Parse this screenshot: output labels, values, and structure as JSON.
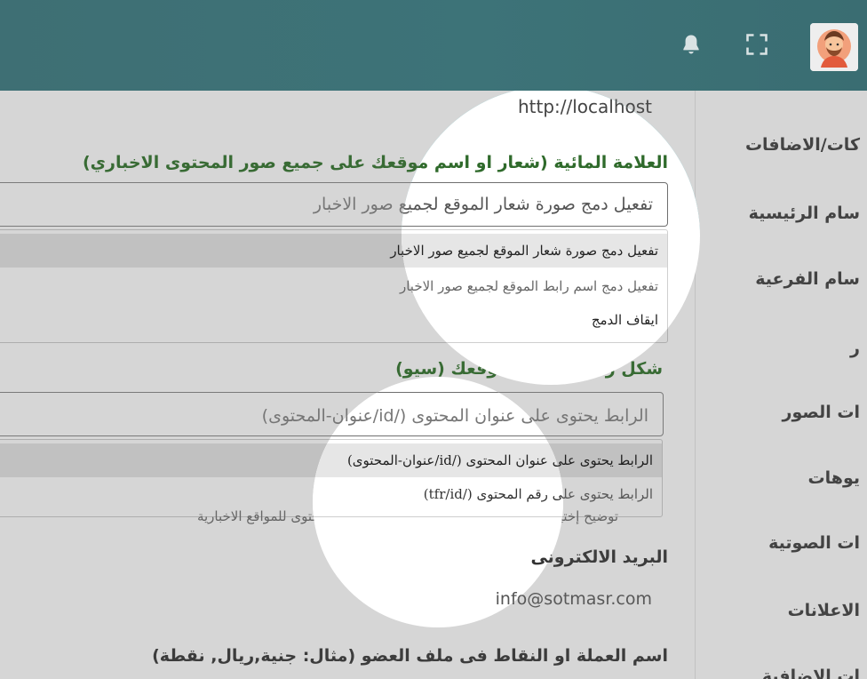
{
  "header": {
    "icons": {
      "bell": "bell-icon",
      "fullscreen": "fullscreen-icon",
      "avatar": "user-avatar"
    },
    "colors": {
      "bar": "#3e6f74",
      "accent": "#2aa7b3"
    }
  },
  "sidebar": {
    "items": [
      "كات/الاضافات",
      "سام الرئيسية",
      "سام الفرعية",
      "ر",
      "ات الصور",
      "يوهات",
      "ات الصوتية",
      "الاعلانات",
      "ات الاضافية"
    ]
  },
  "main": {
    "url_value": "http://localhost",
    "watermark": {
      "label": "العلامة المائية (شعار او اسم موقعك على جميع صور المحتوى الاخباري)",
      "selected": "تفعيل دمج صورة شعار الموقع لجميع صور الاخبار",
      "options": [
        "تفعيل دمج صورة شعار الموقع لجميع صور الاخبار",
        "تفعيل دمج اسم رابط الموقع لجميع صور الاخبار",
        "ايقاف الدمج"
      ]
    },
    "seo": {
      "label": "شكل رابط محتوى موقعك (سيو)",
      "selected": "الرابط يحتوى على عنوان المحتوى (/id/عنوان-المحتوى)",
      "options": [
        "الرابط يحتوى على عنوان المحتوى (/id/عنوان-المحتوى)",
        "الرابط يحتوى على رقم المحتوى (/tfr/id)"
      ],
      "help_text": "توضيح إختيار الرابط المناسب للأخبار الخاصة بإدارة المحتوى للمواقع الاخبارية"
    },
    "email": {
      "label": "البريد الالكترونى",
      "value": "info@sotmasr.com"
    },
    "currency": {
      "label": "اسم العملة او النقاط فى ملف العضو (مثال: جنية,ريال, نقطة)"
    }
  }
}
